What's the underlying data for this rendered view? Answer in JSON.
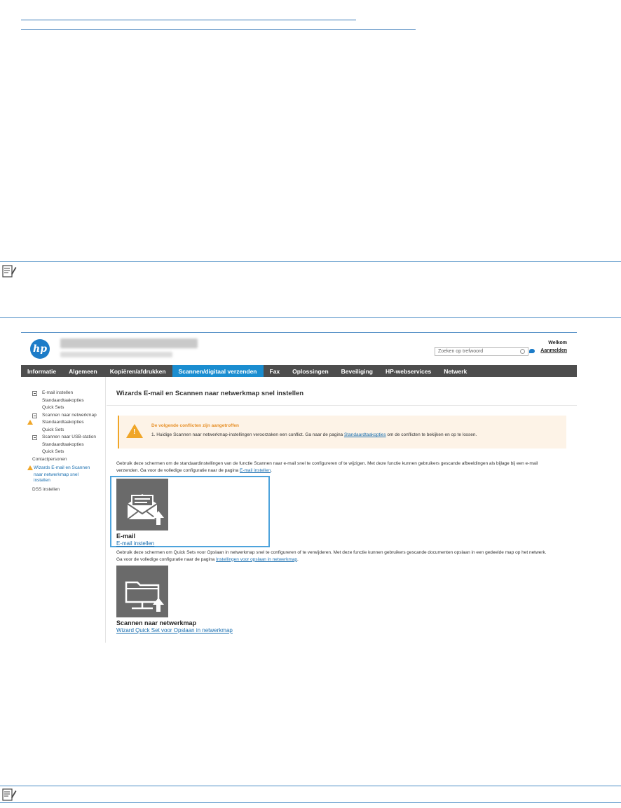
{
  "hp_logo": "hp",
  "header": {
    "search_placeholder": "Zoeken op trefwoord",
    "welcome": "Welkom",
    "sign_in": "Aanmelden"
  },
  "nav": {
    "tabs": [
      {
        "label": "Informatie",
        "active": false
      },
      {
        "label": "Algemeen",
        "active": false
      },
      {
        "label": "Kopiëren/afdrukken",
        "active": false
      },
      {
        "label": "Scannen/digitaal verzenden",
        "active": true
      },
      {
        "label": "Fax",
        "active": false
      },
      {
        "label": "Oplossingen",
        "active": false
      },
      {
        "label": "Beveiliging",
        "active": false
      },
      {
        "label": "HP-webservices",
        "active": false
      },
      {
        "label": "Netwerk",
        "active": false
      }
    ]
  },
  "sidebar": {
    "items": [
      {
        "label": "E-mail instellen",
        "level": "group"
      },
      {
        "label": "Standaardtaakopties",
        "level": "child"
      },
      {
        "label": "Quick Sets",
        "level": "child"
      },
      {
        "label": "Scannen naar netwerkmap",
        "level": "group"
      },
      {
        "label": "Standaardtaakopties",
        "level": "child-warn"
      },
      {
        "label": "Quick Sets",
        "level": "child"
      },
      {
        "label": "Scannen naar USB-station",
        "level": "group"
      },
      {
        "label": "Standaardtaakopties",
        "level": "child"
      },
      {
        "label": "Quick Sets",
        "level": "child"
      },
      {
        "label": "Contactpersonen",
        "level": "top"
      },
      {
        "label": "Wizards E-mail en Scannen",
        "level": "top-warn"
      },
      {
        "label": "naar netwerkmap snel",
        "level": "top-cont"
      },
      {
        "label": "instellen",
        "level": "top-cont"
      },
      {
        "label": "DSS instellen",
        "level": "top"
      }
    ]
  },
  "main": {
    "title": "Wizards E-mail en Scannen naar netwerkmap snel instellen",
    "alert": {
      "heading": "De volgende conflicten zijn aangetroffen",
      "item_prefix": "1.  Huidige Scannen naar netwerkmap-instellingen veroorzaken een conflict. Ga naar de pagina ",
      "item_link": "Standaardtaakopties",
      "item_suffix": " om de conflicten te bekijken en op te lossen."
    },
    "email_desc_1": "Gebruik deze schermen om de standaardinstellingen van de functie Scannen naar e-mail snel te configureren of te wijzigen. Met deze functie kunnen gebruikers gescande afbeeldingen als bijlage bij een e-mail",
    "email_desc_2_prefix": "verzenden. Ga voor de volledige configuratie naar de pagina ",
    "email_desc_2_link": "E-mail instellen",
    "email_desc_2_suffix": ".",
    "email_tile_label": "E-mail",
    "email_tile_link": "E-mail instellen",
    "folder_desc_1": "Gebruik deze schermen om Quick Sets voor Opslaan in netwerkmap snel te configureren of te verwijderen. Met deze functie kunnen gebruikers gescande documenten opslaan in een gedeelde map op het netwerk.",
    "folder_desc_2_prefix": "Ga voor de volledige configuratie naar de pagina ",
    "folder_desc_2_link": "Instellingen voor opslaan in netwerkmap",
    "folder_desc_2_suffix": ".",
    "folder_tile_label": "Scannen naar netwerkmap",
    "folder_tile_link": "Wizard Quick Set voor Opslaan in netwerkmap"
  },
  "colors": {
    "accent": "#1a8dd0",
    "nav_bg": "#4d4d4d",
    "warning": "#f0a628",
    "link": "#1a6fb0"
  }
}
